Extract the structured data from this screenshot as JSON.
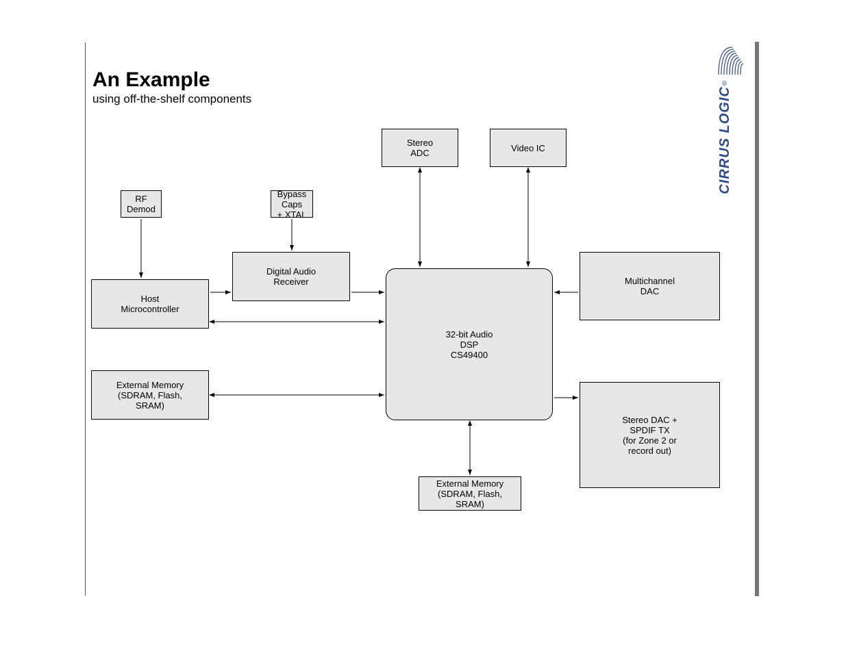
{
  "header": {
    "title": "An Example",
    "subtitle": "using off-the-shelf components"
  },
  "blocks": {
    "dsp": "32-bit Audio\nDSP\nCS49400",
    "stereo_adc": "Stereo\nADC",
    "digital_receiver": "Digital Audio\nReceiver",
    "rf_demod": "RF\nDemod",
    "bypass_caps": "Bypass Caps\n+ XTAL",
    "host_micro": "Host\nMicrocontroller",
    "video": "Video IC",
    "multich_dac": "Multichannel\nDAC",
    "ext_mem": "External Memory\n(SDRAM, Flash,\nSRAM)",
    "stereo_dac_spdif": "Stereo DAC +\nSPDIF TX\n(for Zone 2 or\nrecord out)"
  },
  "logo": {
    "brand": "CIRRUS LOGIC",
    "reg": "®"
  }
}
